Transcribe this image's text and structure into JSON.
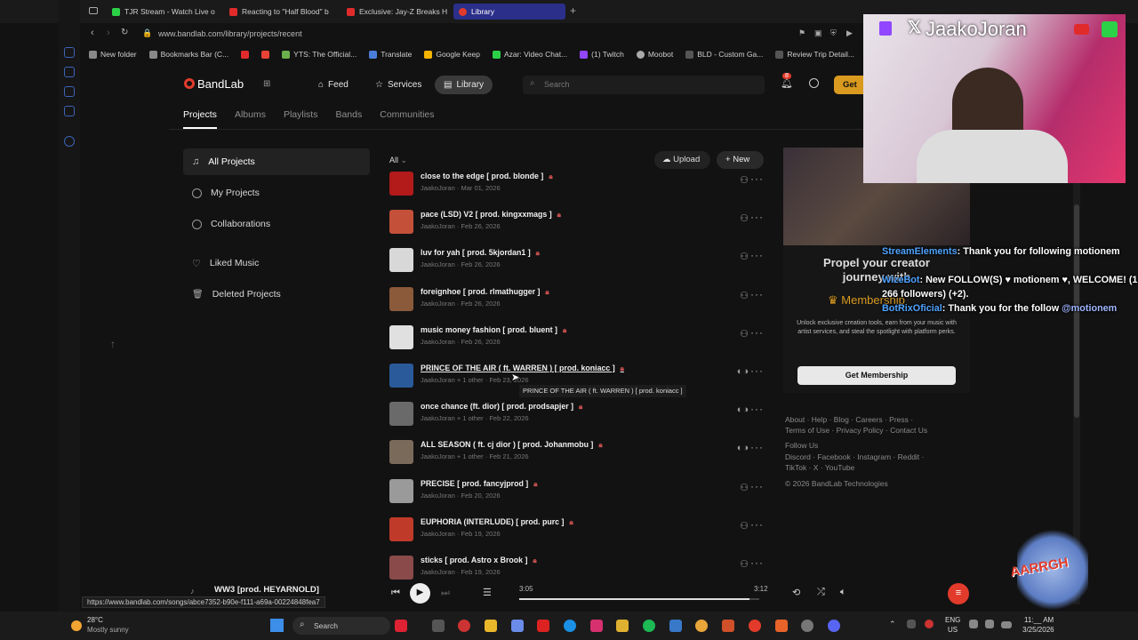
{
  "browser": {
    "tabs": [
      {
        "label": "TJR Stream - Watch Live o",
        "color": "#2bd147"
      },
      {
        "label": "Reacting to \"Half Blood\" b",
        "color": "#e12b2b"
      },
      {
        "label": "Exclusive: Jay-Z Breaks H",
        "color": "#e12b2b"
      },
      {
        "label": "Library",
        "color": "#e23b2b"
      }
    ],
    "url": "www.bandlab.com/library/projects/recent",
    "bookmarks": [
      "New folder",
      "Bookmarks Bar (C...",
      "YTS: The Official...",
      "Translate",
      "Google Keep",
      "Azar: Video Chat...",
      "(1) Twitch",
      "Moobot",
      "BLD - Custom Ga...",
      "Review Trip Detail..."
    ]
  },
  "header": {
    "logo": "BandLab",
    "nav": [
      "Feed",
      "Services",
      "Library"
    ],
    "search_placeholder": "Search",
    "notif_count": "8",
    "get_label": "Get"
  },
  "subnav": [
    "Projects",
    "Albums",
    "Playlists",
    "Bands",
    "Communities"
  ],
  "sidebar": {
    "items": [
      "All Projects",
      "My Projects",
      "Collaborations"
    ],
    "items2": [
      "Liked Music",
      "Deleted Projects"
    ]
  },
  "toolbar": {
    "filter": "All",
    "upload": "Upload",
    "new": "New"
  },
  "projects": [
    {
      "title": "close to the edge [ prod. blonde ]",
      "author": "JaakoJoran",
      "date": "Mar 01, 2026"
    },
    {
      "title": "pace (LSD) V2 [ prod. kingxxmags ]",
      "author": "JaakoJoran",
      "date": "Feb 26, 2026"
    },
    {
      "title": "luv for yah [ prod. 5kjordan1 ]",
      "author": "JaakoJoran",
      "date": "Feb 26, 2026"
    },
    {
      "title": "foreignhoe [ prod. rlmathugger ]",
      "author": "JaakoJoran",
      "date": "Feb 26, 2026"
    },
    {
      "title": "music money fashion [ prod. bluent ]",
      "author": "JaakoJoran",
      "date": "Feb 26, 2026"
    },
    {
      "title": "PRINCE OF THE AIR ( ft. WARREN ) [ prod. koniacc ]",
      "author": "JaakoJoran + 1 other",
      "date": "Feb 23, 2026"
    },
    {
      "title": "once chance (ft. dior) [ prod. prodsapjer ]",
      "author": "JaakoJoran + 1 other",
      "date": "Feb 22, 2026"
    },
    {
      "title": "ALL SEASON ( ft. cj dior ) [ prod. Johanmobu ]",
      "author": "JaakoJoran + 1 other",
      "date": "Feb 21, 2026"
    },
    {
      "title": "PRECISE [ prod. fancyjprod ]",
      "author": "JaakoJoran",
      "date": "Feb 20, 2026"
    },
    {
      "title": "EUPHORIA (INTERLUDE) [ prod. purc ]",
      "author": "JaakoJoran",
      "date": "Feb 19, 2026"
    },
    {
      "title": "sticks [ prod. Astro x Brook ]",
      "author": "JaakoJoran",
      "date": "Feb 19, 2026"
    }
  ],
  "tooltip": "PRINCE OF THE AIR ( ft. WARREN )  [ prod. koniacc ]",
  "promo": {
    "title": "Propel your creator journey with",
    "membership": "Membership",
    "body": "Unlock exclusive creation tools, earn from your music with artist services, and steal the spotlight with platform perks.",
    "button": "Get Membership"
  },
  "footer": {
    "line1": "About · Help · Blog · Careers · Press ·",
    "line2": "Terms of Use · Privacy Policy · Contact Us",
    "line3": "Follow Us",
    "line4": "Discord · Facebook · Instagram · Reddit ·",
    "line5": "TikTok · X · YouTube",
    "copyright": "© 2026 BandLab Technologies"
  },
  "stream": {
    "name": "JaakoJoran",
    "chat": [
      {
        "user": "StreamElements",
        "msg": ": Thank you for following motionem"
      },
      {
        "user": "WizeBot",
        "msg": ": New FOLLOW(S) ♥ motionem ♥, WELCOME! (1 266 followers) (+2)."
      },
      {
        "user": "BotRixOficial",
        "msg": ": Thank you for the follow ",
        "mention": "@motionem"
      }
    ],
    "logo_text": "AARRGH"
  },
  "player": {
    "track": "WW3 [prod. HEYARNOLD]",
    "elapsed": "3:05",
    "total": "3:12",
    "progress": 0.96
  },
  "status_url": "https://www.bandlab.com/songs/abce7352-b90e-f111-a69a-00224848fea7",
  "taskbar": {
    "weather_temp": "28°C",
    "weather_desc": "Mostly sunny",
    "search": "Search",
    "lang1": "ENG",
    "lang2": "US",
    "time": "11:__ AM",
    "date": "3/25/2026"
  }
}
